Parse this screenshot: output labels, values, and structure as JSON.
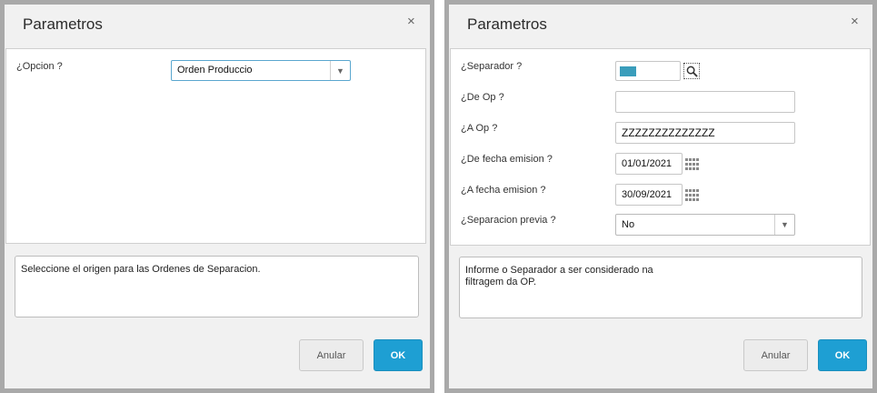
{
  "left_dialog": {
    "title": "Parametros",
    "close": "×",
    "params": [
      {
        "label": "¿Opcion ?",
        "value": "Orden Produccio"
      }
    ],
    "help_text": "Seleccione el origen para las Ordenes de Separacion.",
    "buttons": {
      "cancel": "Anular",
      "ok": "OK"
    }
  },
  "right_dialog": {
    "title": "Parametros",
    "close": "×",
    "params": [
      {
        "label": "¿Separador ?",
        "value": "",
        "swatch_color": "#3a9dbb"
      },
      {
        "label": "¿De Op ?",
        "value": ""
      },
      {
        "label": "¿A Op ?",
        "value": "ZZZZZZZZZZZZZZ"
      },
      {
        "label": "¿De fecha emision ?",
        "value": "01/01/2021"
      },
      {
        "label": "¿A fecha emision ?",
        "value": "30/09/2021"
      },
      {
        "label": "¿Separacion previa ?",
        "value": "No"
      }
    ],
    "help_text": "Informe o Separador  a ser considerado na\nfiltragem da OP.",
    "buttons": {
      "cancel": "Anular",
      "ok": "OK"
    }
  },
  "colors": {
    "accent": "#1e9fd3",
    "frame": "#a9a9a9"
  }
}
